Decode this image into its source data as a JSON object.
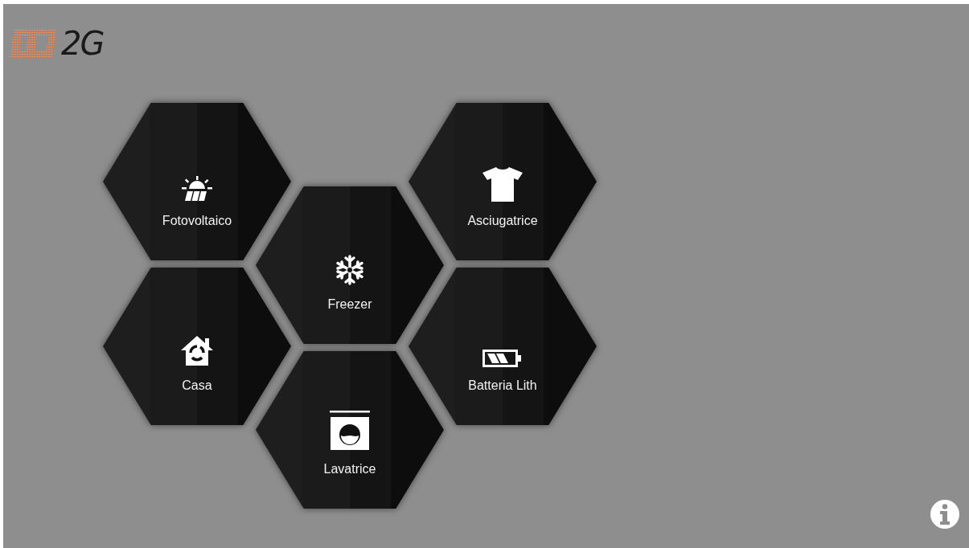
{
  "logo": {
    "text": "2G"
  },
  "tiles": [
    {
      "kind": "solar",
      "label": "Fotovoltaico"
    },
    {
      "kind": "home",
      "label": "Casa"
    },
    {
      "kind": "freezer",
      "label": "Freezer"
    },
    {
      "kind": "washer",
      "label": "Lavatrice"
    },
    {
      "kind": "dryer",
      "label": "Asciugatrice"
    },
    {
      "kind": "battery",
      "label": "Batteria Lith"
    }
  ]
}
